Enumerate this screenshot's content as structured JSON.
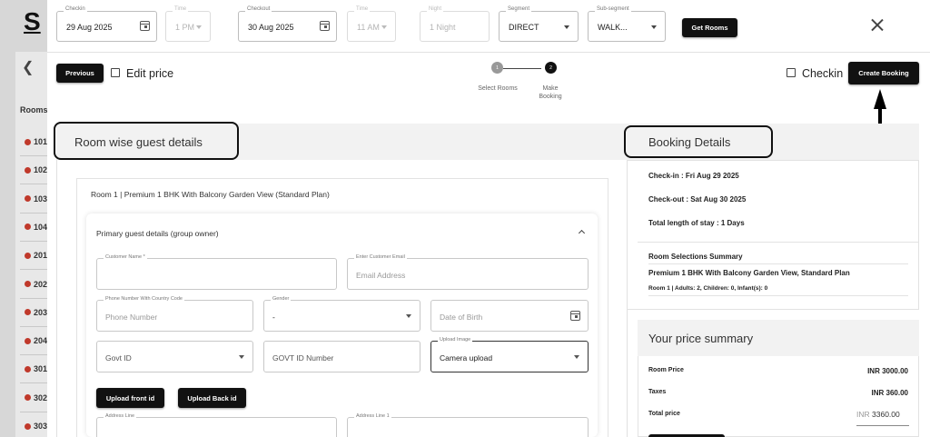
{
  "background": {
    "logo": "S",
    "back_icon": "chevron-left-icon",
    "rooms_label": "Rooms",
    "rooms": [
      "101",
      "102",
      "103",
      "104",
      "201",
      "202",
      "203",
      "204",
      "301",
      "302",
      "303"
    ]
  },
  "topbar": {
    "checkin": {
      "label": "Checkin",
      "value": "29 Aug 2025"
    },
    "checkin_time": {
      "label": "Time",
      "value": "1 PM"
    },
    "checkout": {
      "label": "Checkout",
      "value": "30 Aug 2025"
    },
    "checkout_time": {
      "label": "Time",
      "value": "11 AM"
    },
    "night": {
      "label": "Night",
      "value": "1 Night"
    },
    "segment": {
      "label": "Segment",
      "value": "DIRECT"
    },
    "subsegment": {
      "label": "Sub-segment",
      "value": "WALK..."
    },
    "get_rooms": "Get Rooms"
  },
  "actions": {
    "previous": "Previous",
    "edit_price": "Edit price",
    "checkin": "Checkin",
    "create_booking": "Create Booking"
  },
  "stepper": {
    "steps": [
      {
        "number": "1",
        "label": "Select Rooms",
        "active": false
      },
      {
        "number": "2",
        "label_line1": "Make",
        "label_line2": "Booking",
        "active": true
      }
    ]
  },
  "guest_section": {
    "title": "Room wise guest details",
    "room_title": "Room 1 | Premium 1 BHK With Balcony Garden View (Standard Plan)",
    "primary_title": "Primary guest details (group owner)",
    "fields": {
      "customer_name": {
        "label": "Customer Name *",
        "placeholder": ""
      },
      "email": {
        "label": "Enter Customer Email",
        "placeholder": "Email Address"
      },
      "phone": {
        "label": "Phone Number With Country Code",
        "placeholder": "Phone Number"
      },
      "gender": {
        "label": "Gender",
        "value": "-"
      },
      "dob": {
        "placeholder": "Date of Birth"
      },
      "govt_id": {
        "placeholder": "Govt ID"
      },
      "govt_id_number": {
        "placeholder": "GOVT ID Number"
      },
      "upload_image": {
        "label": "Upload Image",
        "value": "Camera upload"
      },
      "address_line": {
        "label": "Address Line"
      },
      "address_line_1": {
        "label": "Address Line 1"
      }
    },
    "upload_front": "Upload front id",
    "upload_back": "Upload Back id"
  },
  "booking_details": {
    "title": "Booking Details",
    "checkin": "Check-in : Fri Aug 29 2025",
    "checkout": "Check-out : Sat Aug 30 2025",
    "stay": "Total length of stay : 1 Days",
    "summary_title": "Room Selections Summary",
    "room_name": "Premium 1 BHK With Balcony Garden View, Standard Plan",
    "room_occupancy": "Room 1 | Adults: 2, Children: 0, Infant(s): 0"
  },
  "price_summary": {
    "title": "Your price summary",
    "room_price_label": "Room Price",
    "room_price": "INR 3000.00",
    "taxes_label": "Taxes",
    "taxes": "INR 360.00",
    "total_label": "Total price",
    "total_currency": "INR",
    "total_value": "3360.00"
  },
  "colors": {
    "dark_button": "#111111",
    "room_dot": "#c0392b",
    "section_bg": "#f2f2f2"
  }
}
